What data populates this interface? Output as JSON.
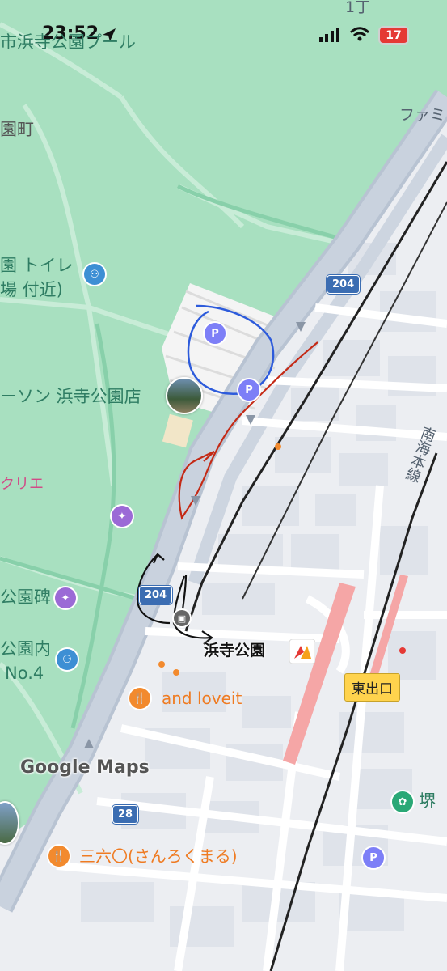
{
  "status_bar": {
    "time": "23:52",
    "battery": "17"
  },
  "labels": {
    "park_pool": "市浜寺公園プール",
    "town": "園町",
    "familymart": "ファミ",
    "toilet": "園 トイレ",
    "toilet2": "場 付近)",
    "lawson": "ーソン 浜寺公園店",
    "kurie": "クリエ",
    "monument": "公園碑",
    "toilet_inner1": "公園内",
    "toilet_inner2": "No.4",
    "top_chome": "1丁",
    "station": "浜寺公園",
    "and_loveit": "and loveit",
    "rokumaru": "三六〇(さんろくまる)",
    "nankai_line": "南海本線",
    "sakai": "堺",
    "east_exit": "東出口",
    "google_maps": "Google Maps"
  },
  "route_shields": {
    "r204_top": "204",
    "r204_bottom": "204",
    "r28": "28"
  },
  "parking_symbol": "P",
  "colors": {
    "park_green": "#a8e0c0",
    "road": "#c7d0dc",
    "railway": "#222222",
    "station_pink": "#f5a6a6",
    "annotation_blue": "#2d5bdb",
    "annotation_red": "#c42a16",
    "annotation_black": "#111111"
  },
  "icons": [
    "navigation-arrow-icon",
    "signal-icon",
    "wifi-icon",
    "battery-icon",
    "parking-icon",
    "park-icon",
    "toilet-icon",
    "restaurant-icon",
    "station-icon",
    "bus-icon",
    "flower-icon"
  ]
}
